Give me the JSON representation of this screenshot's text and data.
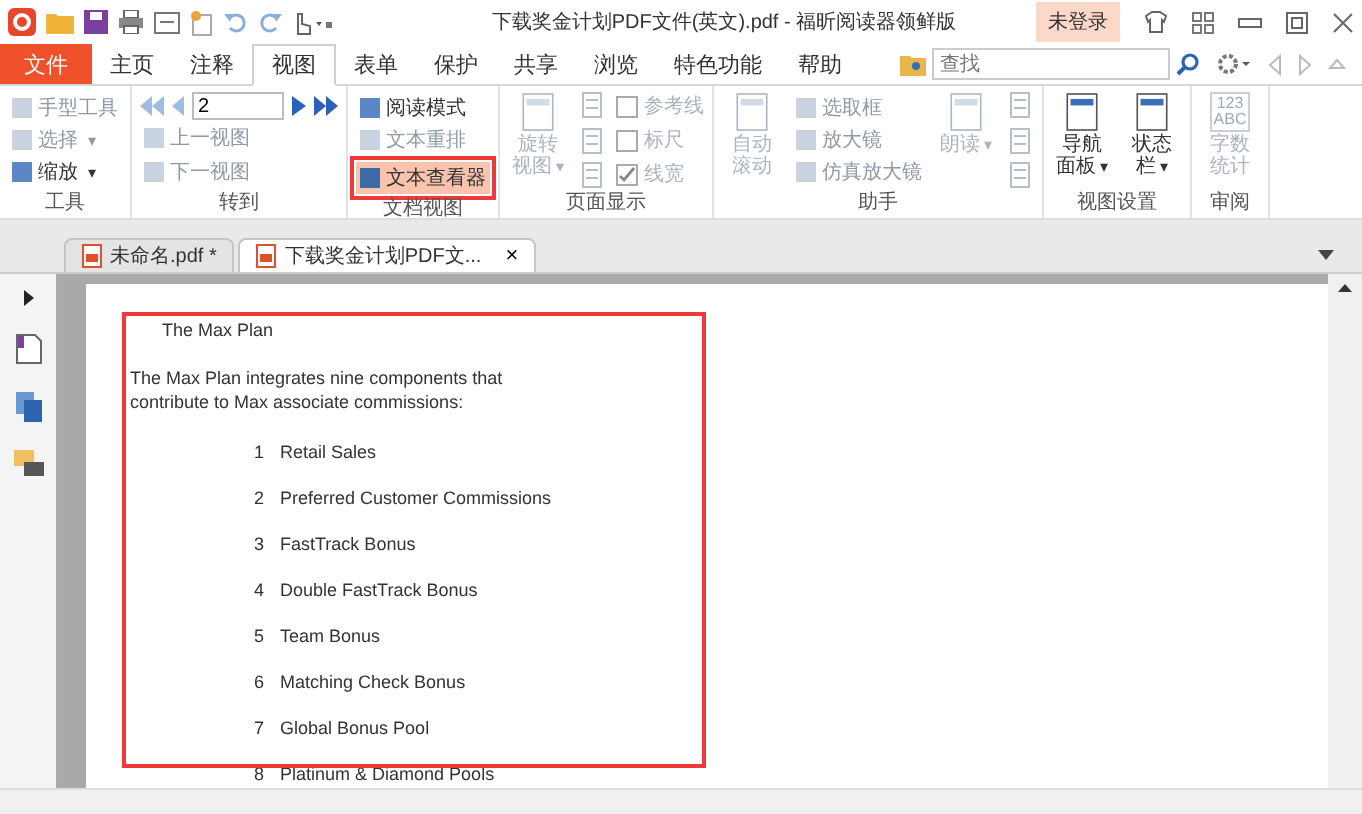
{
  "title": "下载奖金计划PDF文件(英文).pdf - 福昕阅读器领鲜版",
  "login_button": "未登录",
  "menu_tabs": [
    {
      "label": "文件",
      "kind": "file",
      "selected": false
    },
    {
      "label": "主页",
      "kind": "tab",
      "selected": false
    },
    {
      "label": "注释",
      "kind": "tab",
      "selected": false
    },
    {
      "label": "视图",
      "kind": "tab",
      "selected": true
    },
    {
      "label": "表单",
      "kind": "tab",
      "selected": false
    },
    {
      "label": "保护",
      "kind": "tab",
      "selected": false
    },
    {
      "label": "共享",
      "kind": "tab",
      "selected": false
    },
    {
      "label": "浏览",
      "kind": "tab",
      "selected": false
    },
    {
      "label": "特色功能",
      "kind": "tab",
      "selected": false
    },
    {
      "label": "帮助",
      "kind": "tab",
      "selected": false
    }
  ],
  "search": {
    "placeholder": "查找"
  },
  "ribbon_groups": [
    {
      "label": "工具",
      "columns": [
        [
          {
            "kind": "small",
            "label": "手型工具",
            "disabled": true
          },
          {
            "kind": "small",
            "label": "选择",
            "disabled": true,
            "dropdown": "▾"
          },
          {
            "kind": "small",
            "label": "缩放",
            "disabled": false,
            "dropdown": "▾"
          }
        ]
      ]
    },
    {
      "label": "转到",
      "columns": [
        [
          {
            "kind": "pagenav",
            "value": "2",
            "back_disabled": true
          },
          {
            "kind": "small",
            "label": "上一视图",
            "disabled": true
          },
          {
            "kind": "small",
            "label": "下一视图",
            "disabled": true
          }
        ]
      ]
    },
    {
      "label": "文档视图",
      "columns": [
        [
          {
            "kind": "small",
            "label": "阅读模式",
            "disabled": false,
            "selected": false
          },
          {
            "kind": "small",
            "label": "文本重排",
            "disabled": true,
            "selected": false
          },
          {
            "kind": "small",
            "label": "文本查看器",
            "disabled": false,
            "selected": true
          }
        ]
      ]
    },
    {
      "label": "页面显示",
      "columns": [
        [
          {
            "kind": "large",
            "label": "旋转视图",
            "disabled": true,
            "dropdown": "▾"
          }
        ],
        [
          {
            "kind": "iconstack",
            "disabled": true
          }
        ],
        [
          {
            "kind": "check",
            "label": "参考线",
            "checked": false,
            "disabled": true
          },
          {
            "kind": "check",
            "label": "标尺",
            "checked": false,
            "disabled": true
          },
          {
            "kind": "check",
            "label": "线宽",
            "checked": true,
            "disabled": true
          }
        ]
      ]
    },
    {
      "label": "助手",
      "columns": [
        [
          {
            "kind": "large",
            "label": "自动滚动",
            "disabled": true
          }
        ],
        [
          {
            "kind": "small",
            "label": "选取框",
            "disabled": true
          },
          {
            "kind": "small",
            "label": "放大镜",
            "disabled": true
          },
          {
            "kind": "small",
            "label": "仿真放大镜",
            "disabled": true
          }
        ],
        [
          {
            "kind": "large",
            "label": "朗读",
            "disabled": true,
            "dropdown": "▾"
          }
        ],
        [
          {
            "kind": "iconstack",
            "disabled": true
          }
        ]
      ]
    },
    {
      "label": "视图设置",
      "columns": [
        [
          {
            "kind": "large",
            "label": "导航面板",
            "disabled": false,
            "dropdown": "▾"
          }
        ],
        [
          {
            "kind": "large",
            "label": "状态栏",
            "disabled": false,
            "dropdown": "▾"
          }
        ]
      ]
    },
    {
      "label": "审阅",
      "columns": [
        [
          {
            "kind": "large",
            "label": "字数统计",
            "disabled": true,
            "icon_text": [
              "123",
              "ABC"
            ]
          }
        ]
      ]
    }
  ],
  "doc_tabs": [
    {
      "label": "未命名.pdf *",
      "selected": false
    },
    {
      "label": "下载奖金计划PDF文...",
      "selected": true,
      "close": "×"
    }
  ],
  "document": {
    "heading": "The  Max Plan",
    "paragraph": "The Max Plan integrates nine components that contribute to Max associate commissions:",
    "list": [
      {
        "number": "1",
        "text": "Retail Sales"
      },
      {
        "number": "2",
        "text": "Preferred Customer Commissions"
      },
      {
        "number": "3",
        "text": "FastTrack Bonus"
      },
      {
        "number": "4",
        "text": "Double FastTrack Bonus"
      },
      {
        "number": "5",
        "text": "Team Bonus"
      },
      {
        "number": "6",
        "text": "Matching Check Bonus"
      },
      {
        "number": "7",
        "text": "Global Bonus Pool"
      },
      {
        "number": "8",
        "text": "Platinum & Diamond Pools"
      }
    ]
  }
}
